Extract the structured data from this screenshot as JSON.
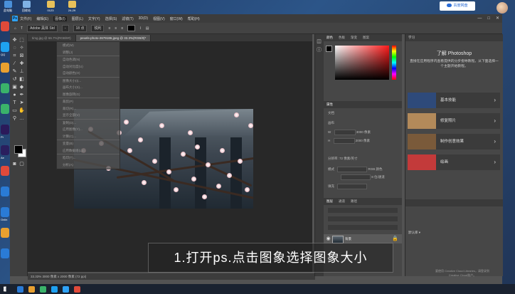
{
  "desktop": {
    "top_icons": [
      {
        "label": "此电脑",
        "color": "#4a90d9"
      },
      {
        "label": "回收站",
        "color": "#7fb2e5"
      },
      {
        "label": "0123",
        "color": "#e8c15a"
      },
      {
        "label": "24-29",
        "color": "#e8c15a"
      }
    ],
    "left_icons": [
      {
        "label": "",
        "color": "#e04a3a"
      },
      {
        "label": "QQ",
        "color": "#1ea1f1"
      },
      {
        "label": "",
        "color": "#e8a030"
      },
      {
        "label": "",
        "color": "#3ab36a"
      },
      {
        "label": "",
        "color": "#3ab36a"
      },
      {
        "label": "Pr",
        "color": "#2b1a5a"
      },
      {
        "label": "Ae",
        "color": "#2a1f5e"
      },
      {
        "label": "",
        "color": "#e04a3a"
      },
      {
        "label": "",
        "color": "#2a7bd6"
      },
      {
        "label": "Onlin",
        "color": "#2a7bd6"
      },
      {
        "label": "",
        "color": "#e8a030"
      },
      {
        "label": "",
        "color": "#2a7bd6"
      }
    ],
    "cloud_button": "百度网盘",
    "accent": "#2a6cd6"
  },
  "ps": {
    "logo": "Ps",
    "menu": [
      "文件(F)",
      "编辑(E)",
      "图像(I)",
      "图层(L)",
      "文字(Y)",
      "选择(S)",
      "滤镜(T)",
      "3D(D)",
      "视图(V)",
      "窗口(W)",
      "帮助(H)"
    ],
    "active_menu_index": 2,
    "window_controls": [
      "—",
      "□",
      "✕"
    ],
    "options": {
      "preset": "Adobe 黑体 Std",
      "style": "-",
      "size": "18 点",
      "aa": "锐利",
      "color": "#000000"
    },
    "tabs": [
      {
        "label": "timg.jpg @ 66.7%(RGB/8#)",
        "active": false
      },
      {
        "label": "pexels-photo-2679186.jpeg @ 33.3%(RGB/8)*",
        "active": true
      }
    ],
    "image_menu": [
      "模式(M)",
      "调整(J)",
      "自动色调(N)",
      "自动对比度(U)",
      "自动颜色(O)",
      "图像大小(I)...",
      "画布大小(S)...",
      "图像旋转(G)",
      "裁剪(P)",
      "裁切(R)...",
      "显示全部(V)",
      "复制(D)...",
      "应用图像(Y)...",
      "计算(C)...",
      "变量(B)",
      "应用数据组(L)...",
      "陷印(T)...",
      "分析(A)"
    ],
    "status": "33.33%   3000 像素 x 2000 像素 (72 ppi)",
    "panels": {
      "color_tabs": [
        "颜色",
        "色板",
        "渐变",
        "图案"
      ],
      "props_title": "属性",
      "props_sub": "文档",
      "canvas_label": "画布",
      "width": "3000 像素",
      "height": "2000 像素",
      "resolution": "分辨率: 72 像素/英寸",
      "mode": "RGB 颜色",
      "depth": "8 位/通道",
      "fill_label": "填充",
      "layers_tabs": [
        "图层",
        "通道",
        "路径"
      ],
      "layer_name": "背景"
    },
    "learn": {
      "header": "学习",
      "title": "了解 Photoshop",
      "desc": "直接在应用程序内查看提供的分步指导教程。从下面选择一个主题开始教程。",
      "cards": [
        {
          "label": "基本技能",
          "thumb": "#2e4a7a"
        },
        {
          "label": "修复照片",
          "thumb": "#b38a5a"
        },
        {
          "label": "制作创意效果",
          "thumb": "#7a5a3a"
        },
        {
          "label": "绘画",
          "thumb": "#c33a3a"
        }
      ],
      "library_tab": "默认库",
      "library_text": "要使用 Creative Cloud Libraries，请登录到 Creative Cloud账户。"
    }
  },
  "caption": "1.打开ps.点击图象选择图象大小",
  "taskbar": {
    "icons": [
      "#2a7bd6",
      "#e8a030",
      "#3ab36a",
      "#1ea1f1",
      "#2fa3f7",
      "#e04a3a"
    ]
  }
}
